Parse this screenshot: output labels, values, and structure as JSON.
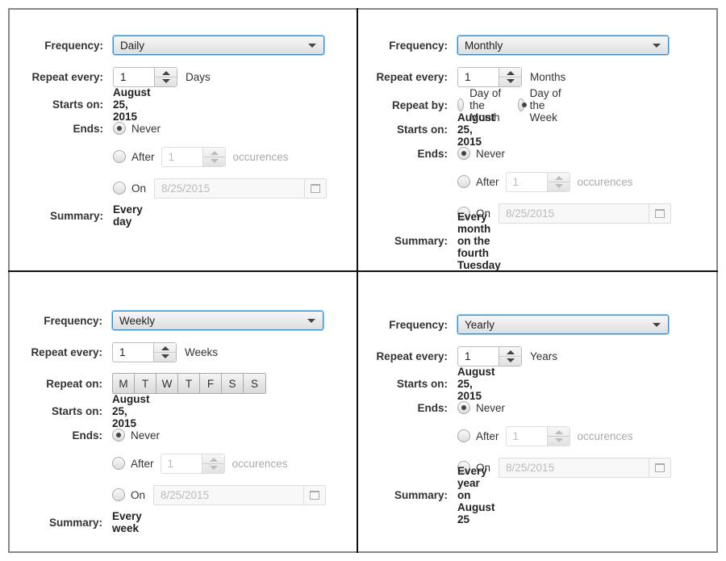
{
  "labels": {
    "frequency": "Frequency:",
    "repeat_every": "Repeat every:",
    "repeat_by": "Repeat by:",
    "repeat_on": "Repeat on:",
    "starts_on": "Starts on:",
    "ends": "Ends:",
    "summary": "Summary:",
    "never": "Never",
    "after": "After",
    "on": "On",
    "occurrences": "occurences"
  },
  "panels": {
    "daily": {
      "frequency": "Daily",
      "repeat_every": "1",
      "unit": "Days",
      "starts_on": "August 25, 2015",
      "ends_selected": "Never",
      "after_value": "1",
      "on_date": "8/25/2015",
      "summary": "Every day"
    },
    "monthly": {
      "frequency": "Monthly",
      "repeat_every": "1",
      "unit": "Months",
      "repeat_by_options": [
        "Day of the Month",
        "Day of the Week"
      ],
      "repeat_by_selected": "Day of the Week",
      "starts_on": "August 25, 2015",
      "ends_selected": "Never",
      "after_value": "1",
      "on_date": "8/25/2015",
      "summary": "Every month on the fourth Tuesday"
    },
    "weekly": {
      "frequency": "Weekly",
      "repeat_every": "1",
      "unit": "Weeks",
      "days": [
        "M",
        "T",
        "W",
        "T",
        "F",
        "S",
        "S"
      ],
      "starts_on": "August 25, 2015",
      "ends_selected": "Never",
      "after_value": "1",
      "on_date": "8/25/2015",
      "summary": "Every week"
    },
    "yearly": {
      "frequency": "Yearly",
      "repeat_every": "1",
      "unit": "Years",
      "starts_on": "August 25, 2015",
      "ends_selected": "Never",
      "after_value": "1",
      "on_date": "8/25/2015",
      "summary": "Every year on August 25"
    }
  },
  "colors": {
    "focus_border": "#2e8fd6",
    "divider": "#111111",
    "outer_frame": "#888888"
  }
}
